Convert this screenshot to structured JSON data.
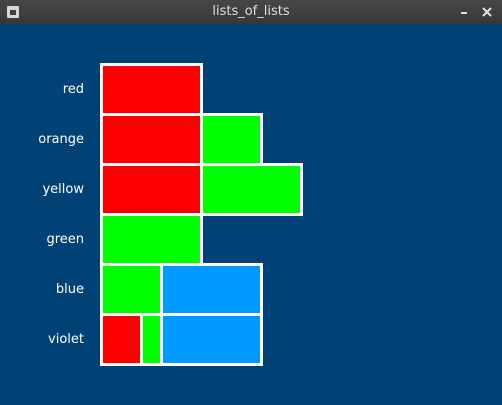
{
  "window": {
    "title": "lists_of_lists"
  },
  "titlebar_icons": {
    "menu": "window-menu-icon",
    "minimize": "minimize-icon",
    "close": "close-icon"
  },
  "colors": {
    "background": "#004275",
    "red": "#ff0000",
    "green": "#00ff00",
    "blue": "#0099ff",
    "cell_border": "#ffffff"
  },
  "chart_data": {
    "type": "bar",
    "orientation": "horizontal",
    "stacked": true,
    "unit": "blocks",
    "categories": [
      "red",
      "orange",
      "yellow",
      "green",
      "blue",
      "violet"
    ],
    "rows": [
      {
        "label": "red",
        "segments": [
          {
            "color": "red",
            "value": 1
          }
        ]
      },
      {
        "label": "orange",
        "segments": [
          {
            "color": "red",
            "value": 1
          },
          {
            "color": "green",
            "value": 0.6
          }
        ]
      },
      {
        "label": "yellow",
        "segments": [
          {
            "color": "red",
            "value": 1
          },
          {
            "color": "green",
            "value": 1
          }
        ]
      },
      {
        "label": "green",
        "segments": [
          {
            "color": "green",
            "value": 1
          }
        ]
      },
      {
        "label": "blue",
        "segments": [
          {
            "color": "green",
            "value": 0.6
          },
          {
            "color": "blue",
            "value": 1
          }
        ]
      },
      {
        "label": "violet",
        "segments": [
          {
            "color": "red",
            "value": 0.4
          },
          {
            "color": "green",
            "value": 0.2
          },
          {
            "color": "blue",
            "value": 1
          }
        ]
      }
    ]
  }
}
